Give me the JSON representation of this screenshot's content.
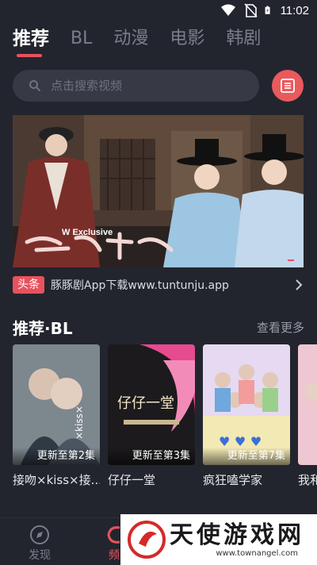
{
  "status": {
    "time": "11:02"
  },
  "tabs": [
    {
      "label": "推荐",
      "active": true
    },
    {
      "label": "BL",
      "active": false
    },
    {
      "label": "动漫",
      "active": false
    },
    {
      "label": "电影",
      "active": false
    },
    {
      "label": "韩剧",
      "active": false
    }
  ],
  "search": {
    "placeholder": "点击搜索视频"
  },
  "banner": {
    "overlay_subtitle": "W Exclusive"
  },
  "headline": {
    "badge": "头条",
    "text": "豚豚剧App下载www.tuntunju.app"
  },
  "section": {
    "title": "推荐·BL",
    "see_more": "查看更多"
  },
  "cards": [
    {
      "title": "接吻×kiss×接...",
      "badge": "更新至第2集"
    },
    {
      "title": "仔仔一堂",
      "badge": "更新至第3集"
    },
    {
      "title": "疯狂嗑学家",
      "badge": "更新至第7集"
    },
    {
      "title": "我和",
      "badge": ""
    }
  ],
  "bottom_nav": [
    {
      "label": "发现",
      "icon": "compass-icon",
      "active": false
    },
    {
      "label": "频",
      "icon": "channel-icon",
      "active": true
    }
  ],
  "watermark": {
    "text": "天使游戏网",
    "url": "www.townangel.com"
  },
  "colors": {
    "accent": "#e8525e",
    "background": "#23252e",
    "search_bg": "#373a45"
  }
}
